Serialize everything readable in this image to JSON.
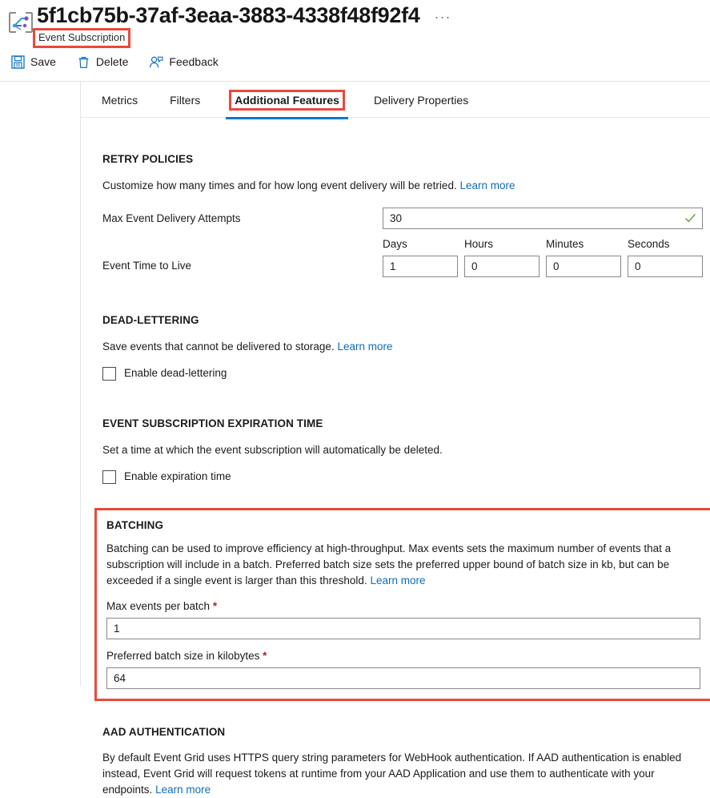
{
  "header": {
    "resource_icon": "event-grid-icon",
    "title": "5f1cb75b-37af-3eaa-3883-4338f48f92f4",
    "subtitle": "Event Subscription",
    "more_menu": "···",
    "highlight_color": "#e8493c"
  },
  "commandbar": {
    "items": [
      {
        "label": "Save",
        "icon": "save-icon"
      },
      {
        "label": "Delete",
        "icon": "trash-icon"
      },
      {
        "label": "Feedback",
        "icon": "feedback-person-icon"
      }
    ]
  },
  "tabs": [
    {
      "label": "Metrics",
      "active": false
    },
    {
      "label": "Filters",
      "active": false
    },
    {
      "label": "Additional Features",
      "active": true
    },
    {
      "label": "Delivery Properties",
      "active": false
    }
  ],
  "sections": {
    "retry": {
      "title": "RETRY POLICIES",
      "description": "Customize how many times and for how long event delivery will be retried.",
      "learn_more": "Learn more",
      "max_attempts": {
        "label": "Max Event Delivery Attempts",
        "value": "30",
        "valid_icon": "checkmark-icon"
      },
      "ttl": {
        "label": "Event Time to Live",
        "columns": [
          {
            "header": "Days",
            "value": "1"
          },
          {
            "header": "Hours",
            "value": "0"
          },
          {
            "header": "Minutes",
            "value": "0"
          },
          {
            "header": "Seconds",
            "value": "0"
          }
        ]
      }
    },
    "dead_lettering": {
      "title": "DEAD-LETTERING",
      "description": "Save events that cannot be delivered to storage.",
      "learn_more": "Learn more",
      "checkbox_label": "Enable dead-lettering",
      "checked": false
    },
    "expiration": {
      "title": "EVENT SUBSCRIPTION EXPIRATION TIME",
      "description": "Set a time at which the event subscription will automatically be deleted.",
      "checkbox_label": "Enable expiration time",
      "checked": false
    },
    "batching": {
      "title": "BATCHING",
      "description": "Batching can be used to improve efficiency at high-throughput. Max events sets the maximum number of events that a subscription will include in a batch. Preferred batch size sets the preferred upper bound of batch size in kb, but can be exceeded if a single event is larger than this threshold.",
      "learn_more": "Learn more",
      "max_events": {
        "label": "Max events per batch",
        "required_marker": "*",
        "value": "1"
      },
      "preferred_size": {
        "label": "Preferred batch size in kilobytes",
        "required_marker": "*",
        "value": "64"
      }
    },
    "aad": {
      "title": "AAD AUTHENTICATION",
      "description": "By default Event Grid uses HTTPS query string parameters for WebHook authentication. If AAD authentication is enabled instead, Event Grid will request tokens at runtime from your AAD Application and use them to authenticate with your endpoints.",
      "learn_more": "Learn more"
    }
  },
  "colors": {
    "accent": "#0078d4",
    "link": "#0f6cbd",
    "annotation": "#e8493c",
    "valid": "#5ea83a",
    "required": "#a4262c"
  }
}
